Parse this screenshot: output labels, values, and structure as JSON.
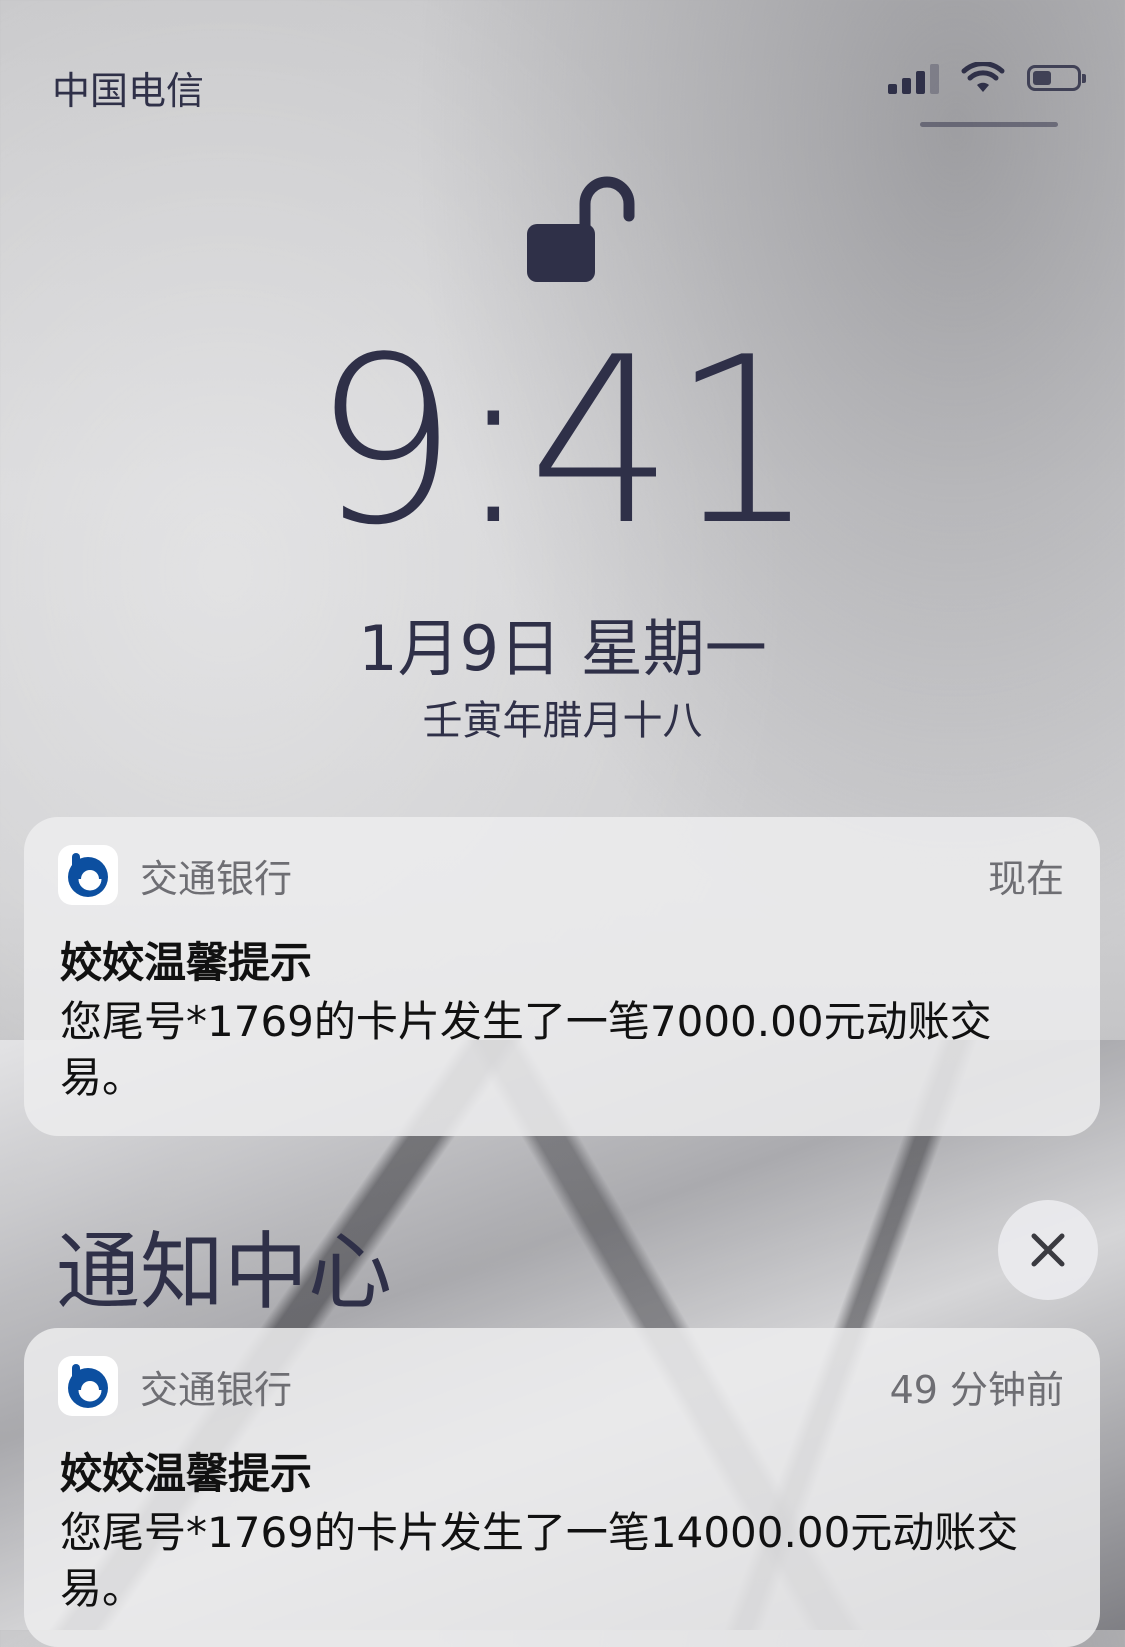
{
  "status_bar": {
    "carrier": "中国电信"
  },
  "lock_screen": {
    "time": "9:41",
    "date": "1月9日 星期一",
    "lunar_date": "壬寅年腊月十八"
  },
  "notifications_top": [
    {
      "app": "交通银行",
      "when": "现在",
      "title": "姣姣温馨提示",
      "body": "您尾号*1769的卡片发生了一笔7000.00元动账交易。"
    }
  ],
  "notification_center": {
    "title": "通知中心",
    "items": [
      {
        "app": "交通银行",
        "when": "49 分钟前",
        "title": "姣姣温馨提示",
        "body": "您尾号*1769的卡片发生了一笔14000.00元动账交易。"
      }
    ]
  },
  "colors": {
    "text": "#2f3048",
    "bank_blue": "#0c4fa0"
  },
  "icons": {
    "lock": "unlocked-padlock-icon",
    "app": "bank-of-communications-logo-icon",
    "close": "close-icon"
  }
}
